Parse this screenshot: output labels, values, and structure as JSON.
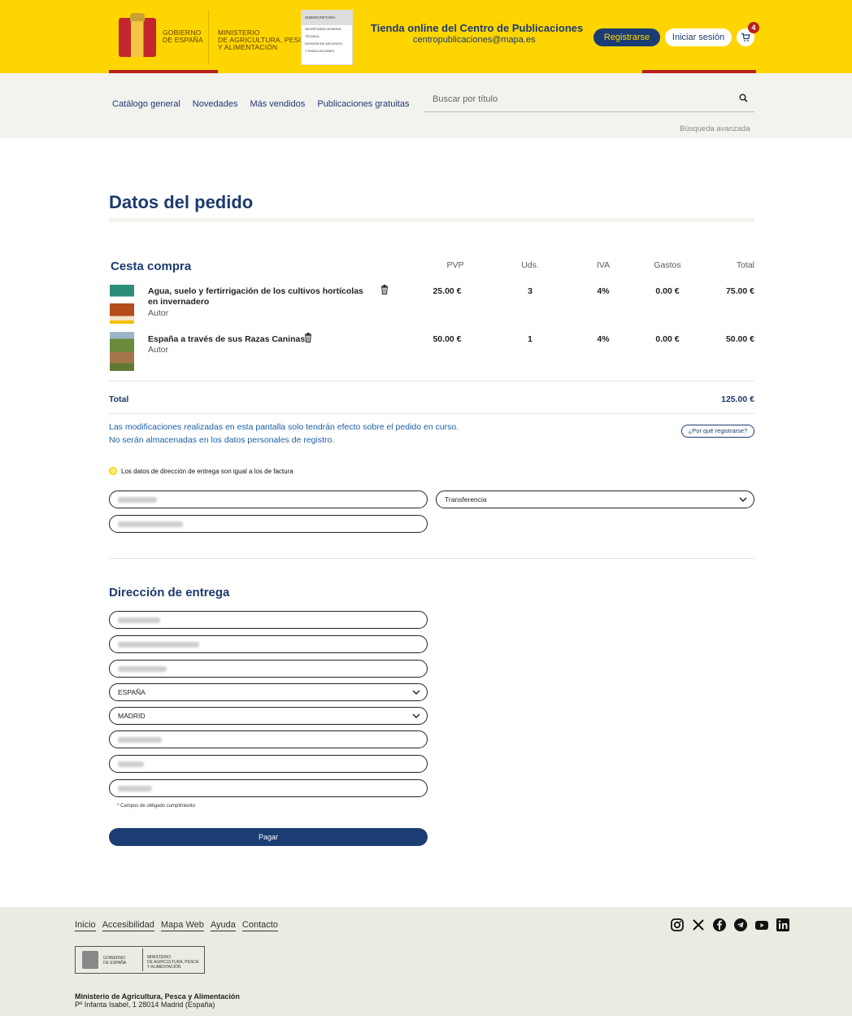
{
  "header": {
    "gov_text": [
      "GOBIERNO",
      "DE ESPAÑA"
    ],
    "ministry_text": [
      "MINISTERIO",
      "DE AGRICULTURA, PESCA",
      "Y ALIMENTACIÓN"
    ],
    "subsecretaria": {
      "head": "SUBSECRETARÍA",
      "lines": [
        "SECRETARÍA GENERAL",
        "TÉCNICA",
        "DIVISIÓN DE ARCHIVOS",
        "Y PUBLICACIONES"
      ]
    },
    "store_title": "Tienda online del Centro de Publicaciones",
    "store_email": "centropublicaciones@mapa.es",
    "register_label": "Registrarse",
    "login_label": "Iniciar sesión",
    "cart_count": "4"
  },
  "nav": {
    "links": [
      "Catálogo general",
      "Novedades",
      "Más vendidos",
      "Publicaciones gratuitas"
    ],
    "search_placeholder": "Buscar por título",
    "advanced_search": "Búsqueda avanzada"
  },
  "page": {
    "title": "Datos del pedido"
  },
  "cart": {
    "heading": "Cesta compra",
    "columns": [
      "PVP",
      "Uds.",
      "IVA",
      "Gastos",
      "Total"
    ],
    "items": [
      {
        "title_lines": [
          "Agua, suelo y fertirrigación de los cultivos hortícolas",
          "en invernadero"
        ],
        "author": "Autor",
        "pvp": "25.00 €",
        "uds": "3",
        "iva": "4%",
        "gastos": "0.00 €",
        "total": "75.00 €"
      },
      {
        "title_lines": [
          "España a través de sus Razas Caninas"
        ],
        "author": "Autor",
        "pvp": "50.00 €",
        "uds": "1",
        "iva": "4%",
        "gastos": "0.00 €",
        "total": "50.00 €"
      }
    ],
    "total_label": "Total",
    "total_value": "125.00 €"
  },
  "notice": {
    "line1": "Las modificaciones realizadas en esta pantalla solo tendrán efecto sobre el pedido en curso.",
    "line2": "No serán almacenadas en los datos personales de registro.",
    "why_register": "¿Por qué registrarse?"
  },
  "billing": {
    "same_address_label": "Los datos de dirección de entrega son igual a los de factura",
    "payment_method": "Transferencia"
  },
  "delivery": {
    "heading": "Dirección de entrega",
    "country": "ESPAÑA",
    "province": "MADRID",
    "required_note": "* Campos de obligado cumplimiento",
    "pay_label": "Pagar"
  },
  "footer": {
    "links": [
      "Inicio",
      "Accesibilidad",
      "Mapa Web",
      "Ayuda",
      "Contacto"
    ],
    "logo_gov": [
      "GOBIERNO",
      "DE ESPAÑA"
    ],
    "logo_ministry": [
      "MINISTERIO",
      "DE AGRICULTURA, PESCA",
      "Y ALIMENTACIÓN"
    ],
    "ministry_name": "Ministerio de Agricultura, Pesca y Alimentación",
    "ministry_address": "Pº Infanta Isabel, 1 28014 Madrid (España)",
    "social_icons": [
      "instagram-icon",
      "x-icon",
      "facebook-icon",
      "telegram-icon",
      "youtube-icon",
      "linkedin-icon"
    ]
  },
  "colors": {
    "header_yellow": "#ffd500",
    "brand_navy": "#1b3d73",
    "accent_red": "#b8211b",
    "footer_bg": "#ecebe2"
  }
}
